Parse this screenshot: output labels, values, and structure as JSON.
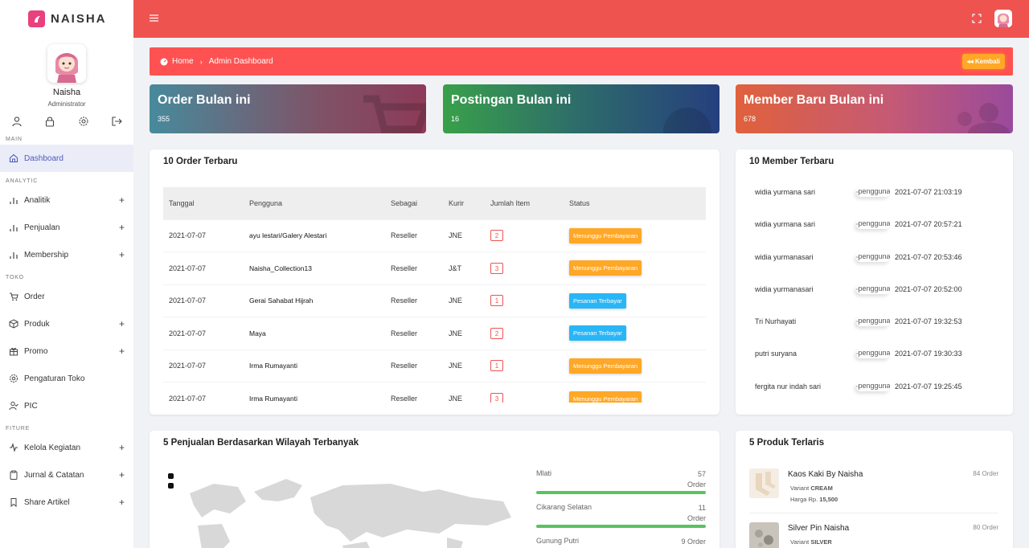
{
  "brand": {
    "name": "NAISHA"
  },
  "profile": {
    "name": "Naisha",
    "role": "Administrator"
  },
  "sidebar": {
    "sections": {
      "main": "MAIN",
      "analytic": "ANALYTIC",
      "toko": "TOKO",
      "fiture": "FITURE"
    },
    "items": [
      {
        "label": "Dashboard",
        "expandable": false,
        "active": true
      },
      {
        "label": "Analitik",
        "expandable": true
      },
      {
        "label": "Penjualan",
        "expandable": true
      },
      {
        "label": "Membership",
        "expandable": true
      },
      {
        "label": "Order",
        "expandable": false
      },
      {
        "label": "Produk",
        "expandable": true
      },
      {
        "label": "Promo",
        "expandable": true
      },
      {
        "label": "Pengaturan Toko",
        "expandable": false
      },
      {
        "label": "PIC",
        "expandable": false
      },
      {
        "label": "Kelola Kegiatan",
        "expandable": true
      },
      {
        "label": "Jurnal & Catatan",
        "expandable": true
      },
      {
        "label": "Share Artikel",
        "expandable": true
      }
    ],
    "plus": "+"
  },
  "breadcrumb": {
    "home": "Home",
    "separator": "›",
    "current": "Admin Dashboard",
    "back_button": "Kembali"
  },
  "stats": [
    {
      "title": "Order Bulan ini",
      "value": "355"
    },
    {
      "title": "Postingan Bulan ini",
      "value": "16"
    },
    {
      "title": "Member Baru Bulan ini",
      "value": "678"
    }
  ],
  "orders": {
    "title": "10 Order Terbaru",
    "columns": [
      "Tanggal",
      "Pengguna",
      "Sebagai",
      "Kurir",
      "Jumlah Item",
      "Status"
    ],
    "rows": [
      {
        "date": "2021-07-07",
        "user": "ayu lestari/Galery Alestari",
        "role": "Reseller",
        "courier": "JNE",
        "qty": "2",
        "status": "Menunggu Pembayaran",
        "status_type": "orange"
      },
      {
        "date": "2021-07-07",
        "user": "Naisha_Collection13",
        "role": "Reseller",
        "courier": "J&T",
        "qty": "3",
        "status": "Menunggu Pembayaran",
        "status_type": "orange"
      },
      {
        "date": "2021-07-07",
        "user": "Gerai Sahabat Hijrah",
        "role": "Reseller",
        "courier": "JNE",
        "qty": "1",
        "status": "Pesanan Terbayar",
        "status_type": "blue"
      },
      {
        "date": "2021-07-07",
        "user": "Maya",
        "role": "Reseller",
        "courier": "JNE",
        "qty": "2",
        "status": "Pesanan Terbayar",
        "status_type": "blue"
      },
      {
        "date": "2021-07-07",
        "user": "Irma Rumayanti",
        "role": "Reseller",
        "courier": "JNE",
        "qty": "1",
        "status": "Menunggu Pembayaran",
        "status_type": "orange"
      },
      {
        "date": "2021-07-07",
        "user": "Irma Rumayanti",
        "role": "Reseller",
        "courier": "JNE",
        "qty": "3",
        "status": "Menunggu Pembayaran",
        "status_type": "orange"
      }
    ]
  },
  "members": {
    "title": "10 Member Terbaru",
    "img_alt": "pengguna",
    "rows": [
      {
        "name": "widia yurmana sari",
        "date": "2021-07-07 21:03:19"
      },
      {
        "name": "widia yurmana sari",
        "date": "2021-07-07 20:57:21"
      },
      {
        "name": "widia yurmanasari",
        "date": "2021-07-07 20:53:46"
      },
      {
        "name": "widia yurmanasari",
        "date": "2021-07-07 20:52:00"
      },
      {
        "name": "Tri Nurhayati",
        "date": "2021-07-07 19:32:53"
      },
      {
        "name": "putri suryana",
        "date": "2021-07-07 19:30:33"
      },
      {
        "name": "fergita nur indah sari",
        "date": "2021-07-07 19:25:45"
      }
    ]
  },
  "regions": {
    "title": "5 Penjualan Berdasarkan Wilayah Terbanyak",
    "rows": [
      {
        "name": "Mlati",
        "count": "57",
        "unit": "Order",
        "fill_pct": 100
      },
      {
        "name": "Cikarang Selatan",
        "count": "11",
        "unit": "Order",
        "fill_pct": 100
      },
      {
        "name": "Gunung Putri",
        "count": "9",
        "unit": "Order",
        "fill_pct": 100
      }
    ]
  },
  "products": {
    "title": "5 Produk Terlaris",
    "rows": [
      {
        "name": "Kaos Kaki By Naisha",
        "variant_label": "Variant",
        "variant": "CREAM",
        "price_label": "Harga Rp.",
        "price": "15,500",
        "orders": "84 Order"
      },
      {
        "name": "Silver Pin Naisha",
        "variant_label": "Variant",
        "variant": "SILVER",
        "price_label": "",
        "price": "",
        "orders": "80 Order"
      }
    ]
  },
  "colors": {
    "topbar": "#ef5350",
    "breadcrumb": "#fe5252",
    "accent": "#4e5bbd",
    "orange": "#ffa726",
    "blue": "#29b6f6",
    "progress": "#5ac35e"
  }
}
